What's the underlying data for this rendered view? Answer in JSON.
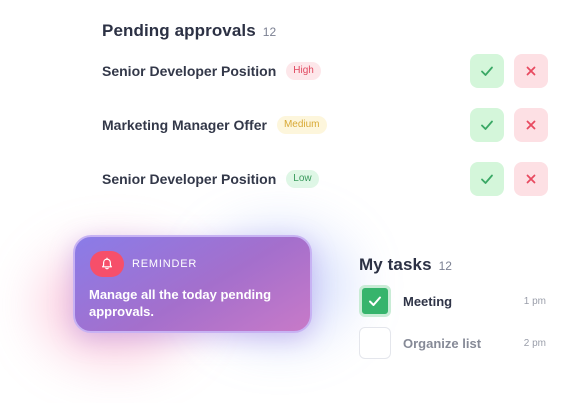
{
  "pending": {
    "title": "Pending approvals",
    "count": "12",
    "items": [
      {
        "name": "Senior Developer Position",
        "priority": "High",
        "badge_bg": "#fde7ea",
        "badge_fg": "#e0485f"
      },
      {
        "name": "Marketing Manager Offer",
        "priority": "Medium",
        "badge_bg": "#fdf6dc",
        "badge_fg": "#d8a935"
      },
      {
        "name": "Senior Developer Position",
        "priority": "Low",
        "badge_bg": "#dff7e6",
        "badge_fg": "#3a9b5c"
      }
    ]
  },
  "reminder": {
    "label": "REMINDER",
    "text": "Manage all the today pending approvals."
  },
  "tasks": {
    "title": "My tasks",
    "count": "12",
    "items": [
      {
        "name": "Meeting",
        "time": "1 pm",
        "checked": true
      },
      {
        "name": "Organize list",
        "time": "2 pm",
        "checked": false
      }
    ]
  },
  "colors": {
    "approve_bg": "#d4f6da",
    "approve_icon": "#3aa865",
    "reject_bg": "#fde0e4",
    "reject_icon": "#e84a60",
    "reminder_accent": "#f64f6a",
    "task_checked": "#36b46c"
  },
  "icons": {
    "approve": "check-icon",
    "reject": "close-icon",
    "reminder": "bell-icon",
    "task_done": "check-icon"
  }
}
